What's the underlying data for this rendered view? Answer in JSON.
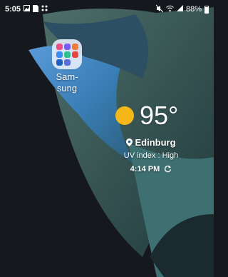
{
  "status_bar": {
    "time": "5:05",
    "left_icons": [
      "gallery-icon",
      "sim-icon",
      "apps-grid-icon"
    ],
    "right_icons": [
      "mute-icon",
      "wifi-icon",
      "signal-icon"
    ],
    "battery": "88%"
  },
  "home": {
    "folder": {
      "label": "Sam-\nsung",
      "app_colors": [
        "#ea4f8a",
        "#7a5cf0",
        "#f07a3a",
        "#3a8ef0",
        "#2fbf8f",
        "#e8453c",
        "#1f5fc4",
        "#5b6fd6"
      ]
    },
    "weather": {
      "temperature": "95°",
      "location": "Edinburg",
      "uv": "UV index : High",
      "updated_time": "4:14 PM",
      "condition_icon": "sun-icon"
    }
  }
}
